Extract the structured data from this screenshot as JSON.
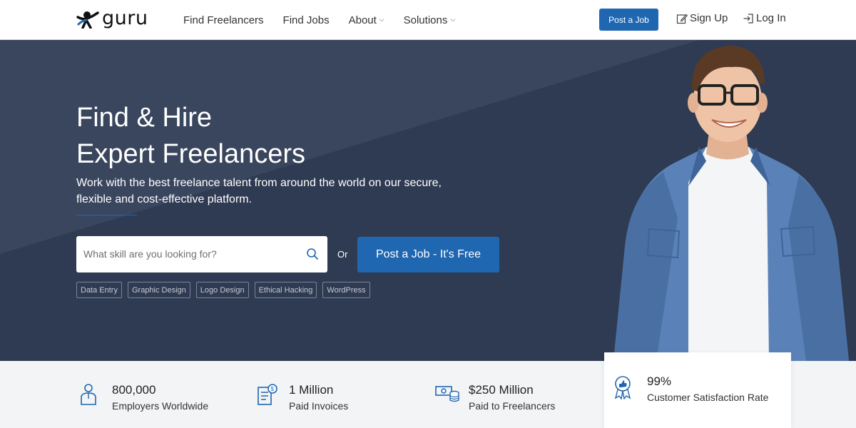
{
  "header": {
    "logo_text": "guru",
    "nav": [
      {
        "label": "Find Freelancers",
        "dropdown": false
      },
      {
        "label": "Find Jobs",
        "dropdown": false
      },
      {
        "label": "About",
        "dropdown": true
      },
      {
        "label": "Solutions",
        "dropdown": true
      }
    ],
    "post_job_label": "Post a Job",
    "signup_label": "Sign Up",
    "login_label": "Log In"
  },
  "hero": {
    "title_line1": "Find & Hire",
    "title_line2": "Expert Freelancers",
    "subtitle": "Work with the best freelance talent from around the world on our secure, flexible and cost-effective platform.",
    "search_placeholder": "What skill are you looking for?",
    "or_label": "Or",
    "post_job_free_label": "Post a Job - It's Free",
    "tags": [
      "Data Entry",
      "Graphic Design",
      "Logo Design",
      "Ethical Hacking",
      "WordPress"
    ]
  },
  "stats": [
    {
      "value": "800,000",
      "label": "Employers Worldwide",
      "icon": "employer-icon"
    },
    {
      "value": "1 Million",
      "label": "Paid Invoices",
      "icon": "invoice-icon"
    },
    {
      "value": "$250 Million",
      "label": "Paid to Freelancers",
      "icon": "money-icon"
    },
    {
      "value": "99%",
      "label": "Customer Satisfaction Rate",
      "icon": "award-icon"
    }
  ],
  "colors": {
    "brand_blue": "#1f67b1",
    "hero_bg": "#2f3b52",
    "stats_bg": "#f3f4f6"
  }
}
